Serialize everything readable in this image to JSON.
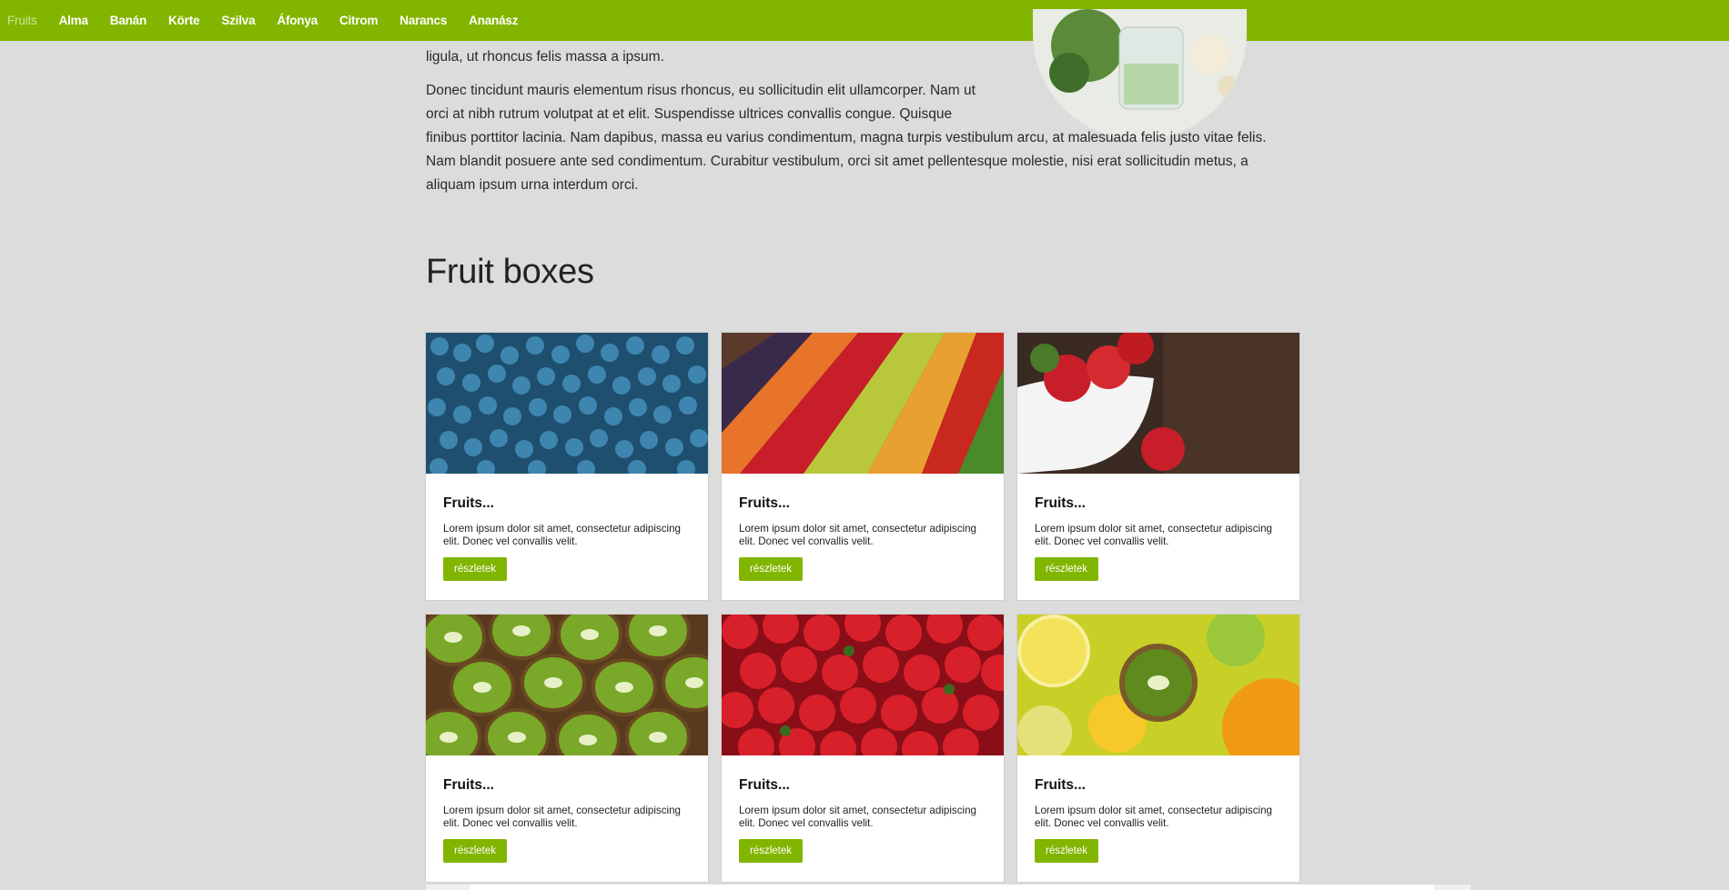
{
  "nav": {
    "items": [
      {
        "label": "Fruits",
        "active": true
      },
      {
        "label": "Alma",
        "active": false
      },
      {
        "label": "Banán",
        "active": false
      },
      {
        "label": "Körte",
        "active": false
      },
      {
        "label": "Szilva",
        "active": false
      },
      {
        "label": "Áfonya",
        "active": false
      },
      {
        "label": "Citrom",
        "active": false
      },
      {
        "label": "Narancs",
        "active": false
      },
      {
        "label": "Ananász",
        "active": false
      }
    ]
  },
  "intro": {
    "line": "ligula, ut rhoncus felis massa a ipsum.",
    "para_narrow": "Donec tincidunt mauris elementum risus rhoncus, eu sollicitudin elit ullamcorper. Nam ut orci at nibh rutrum volutpat at et elit. Suspendisse ultrices convallis congue. Quisque",
    "para_rest": "finibus porttitor lacinia. Nam dapibus, massa eu varius condimentum, magna turpis vestibulum arcu, at malesuada felis justo vitae felis. Nam blandit posuere ante sed condimentum. Curabitur vestibulum, orci sit amet pellentesque molestie, nisi erat sollicitudin metus, a aliquam ipsum urna interdum orci."
  },
  "section": {
    "title": "Fruit boxes"
  },
  "cards": [
    {
      "title": "Fruits...",
      "text": "Lorem ipsum dolor sit amet, consectetur adipiscing elit. Donec vel convallis velit.",
      "button": "részletek",
      "image": "blueberries"
    },
    {
      "title": "Fruits...",
      "text": "Lorem ipsum dolor sit amet, consectetur adipiscing elit. Donec vel convallis velit.",
      "button": "részletek",
      "image": "market-vegetables"
    },
    {
      "title": "Fruits...",
      "text": "Lorem ipsum dolor sit amet, consectetur adipiscing elit. Donec vel convallis velit.",
      "button": "részletek",
      "image": "strawberries-bowl"
    },
    {
      "title": "Fruits...",
      "text": "Lorem ipsum dolor sit amet, consectetur adipiscing elit. Donec vel convallis velit.",
      "button": "részletek",
      "image": "kiwi-slices"
    },
    {
      "title": "Fruits...",
      "text": "Lorem ipsum dolor sit amet, consectetur adipiscing elit. Donec vel convallis velit.",
      "button": "részletek",
      "image": "strawberries"
    },
    {
      "title": "Fruits...",
      "text": "Lorem ipsum dolor sit amet, consectetur adipiscing elit. Donec vel convallis velit.",
      "button": "részletek",
      "image": "citrus-kiwi"
    }
  ],
  "colors": {
    "accent": "#82b500",
    "background": "#dcdcdc"
  }
}
